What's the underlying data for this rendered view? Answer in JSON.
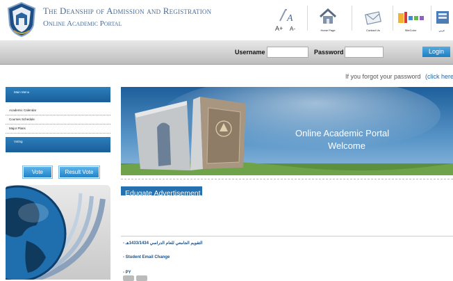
{
  "header": {
    "title_line1": "The Deanship of Admission and Registration",
    "title_line2": "Online Academic Portal",
    "font_larger": "A+",
    "font_smaller": "A-",
    "tools": [
      {
        "label": "Home Page",
        "icon": "home-icon"
      },
      {
        "label": "Contact Us",
        "icon": "contact-icon"
      },
      {
        "label": "SiteColor",
        "icon": "palette-icon"
      },
      {
        "label": "عربي",
        "icon": "arabic-icon"
      }
    ]
  },
  "login": {
    "username_label": "Username",
    "username_value": "",
    "password_label": "Password",
    "password_value": "",
    "button_label": "Login"
  },
  "forgot": {
    "text": "If you forgot your password",
    "link": "(click here"
  },
  "sidebar": {
    "main_menu_title": "Main Menu",
    "items": [
      {
        "label": "Academic Calendar"
      },
      {
        "label": "Courses Schedule"
      },
      {
        "label": "Major Plans"
      }
    ],
    "voting_title": "Voting",
    "vote_label": "Vote",
    "result_vote_label": "Result Vote"
  },
  "banner": {
    "line1": "Online Academic Portal",
    "line2": "Welcome"
  },
  "ads": {
    "title": "Edugate Advertisement"
  },
  "news": [
    {
      "text": "- التقويم الجامعي للعام الدراسي 1433/1434هـ"
    },
    {
      "text": "- Student Email Change"
    },
    {
      "text": "- PY"
    }
  ],
  "colors": {
    "accent_blue": "#2571b0",
    "title_blue": "#4a6e97",
    "login_blue": "#1b7fc4"
  }
}
